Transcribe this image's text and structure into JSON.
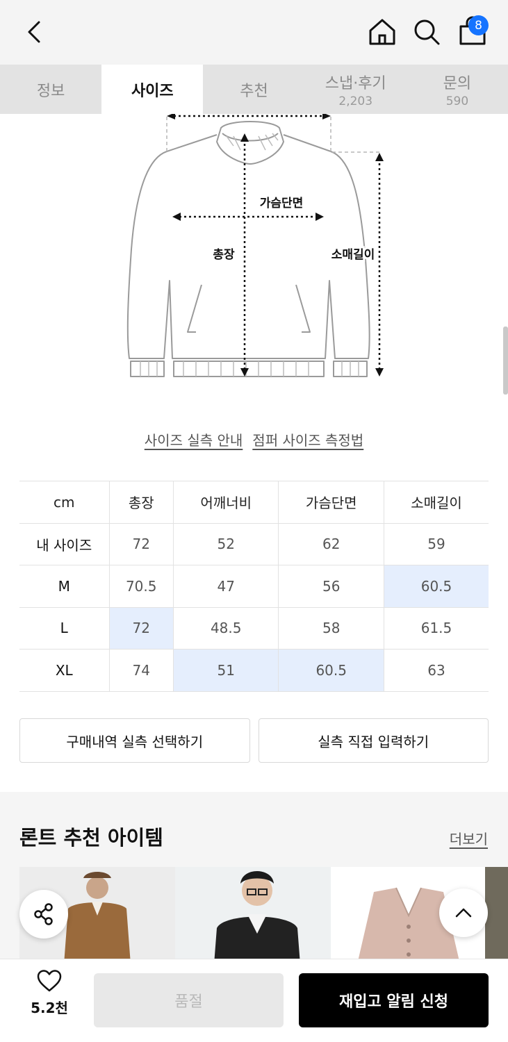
{
  "header": {
    "cart_count": "8",
    "icons": [
      "back-arrow-icon",
      "home-icon",
      "search-icon",
      "shopping-bag-icon"
    ]
  },
  "tabs": [
    {
      "label": "정보",
      "sub": ""
    },
    {
      "label": "사이즈",
      "sub": ""
    },
    {
      "label": "추천",
      "sub": ""
    },
    {
      "label": "스냅·후기",
      "sub": "2,203"
    },
    {
      "label": "문의",
      "sub": "590"
    }
  ],
  "diagram": {
    "chest_label": "가슴단면",
    "length_label": "총장",
    "sleeve_label": "소매길이"
  },
  "guide_links": {
    "measure_guide": "사이즈 실측 안내",
    "jumper_method": "점퍼 사이즈 측정법"
  },
  "size_table": {
    "headers": [
      "cm",
      "총장",
      "어깨너비",
      "가슴단면",
      "소매길이"
    ],
    "rows": [
      [
        "내 사이즈",
        "72",
        "52",
        "62",
        "59"
      ],
      [
        "M",
        "70.5",
        "47",
        "56",
        "60.5"
      ],
      [
        "L",
        "72",
        "48.5",
        "58",
        "61.5"
      ],
      [
        "XL",
        "74",
        "51",
        "60.5",
        "63"
      ]
    ],
    "highlight_color": "#e5eefd"
  },
  "buttons": {
    "purchase_history": "구매내역 실측 선택하기",
    "direct_input": "실측 직접 입력하기"
  },
  "recommend": {
    "title": "론트 추천 아이템",
    "more": "더보기"
  },
  "bottom": {
    "like_count": "5.2천",
    "soldout": "품절",
    "restock": "재입고 알림 신청"
  },
  "colors": {
    "accent": "#1573ff",
    "cta": "#000000"
  }
}
